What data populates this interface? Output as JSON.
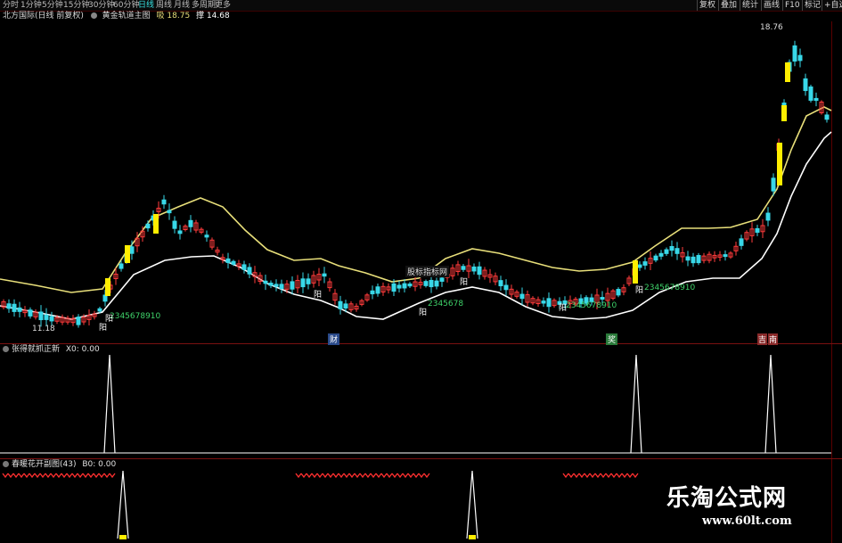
{
  "toolbar": {
    "periods": [
      "分时",
      "1分钟",
      "5分钟",
      "15分钟",
      "30分钟",
      "60分钟",
      "日线",
      "周线",
      "月线",
      "多周期",
      "更多"
    ],
    "active_period": "日线",
    "buttons": [
      "复权",
      "叠加",
      "统计",
      "画线",
      "F10",
      "标记"
    ],
    "auto_label": "+自选"
  },
  "main": {
    "title": "北方国际(日线 前复权)",
    "indicator": "黄金轨道主图",
    "up_label": "18.75",
    "up_label_prefix": "吸",
    "dn_label_prefix": "撑",
    "dn_label": "14.68",
    "high_mark": "18.76",
    "low_mark": "11.18",
    "mid_label": "股标指标网",
    "count_label_1": "2345678910",
    "count_label_2": "2345678",
    "count_label_3": "2345678910",
    "count_label_4": "2345678910",
    "yang": "阳",
    "tag_cai": "财",
    "tag_jiang": "奖",
    "tag_ji": "吉",
    "tag_nan": "南"
  },
  "panel2": {
    "title": "张得就抓正新",
    "value": "X0: 0.00"
  },
  "panel3": {
    "title": "春暖花开副图(43)",
    "value": "B0: 0.00"
  },
  "watermark": {
    "title": "乐淘公式网",
    "url": "www.60lt.com"
  },
  "colors": {
    "up": "#ff3b3b",
    "down": "#38d8e8",
    "band": "#e8df7a",
    "lower": "#ffffff",
    "yellow": "#ffee00"
  }
}
